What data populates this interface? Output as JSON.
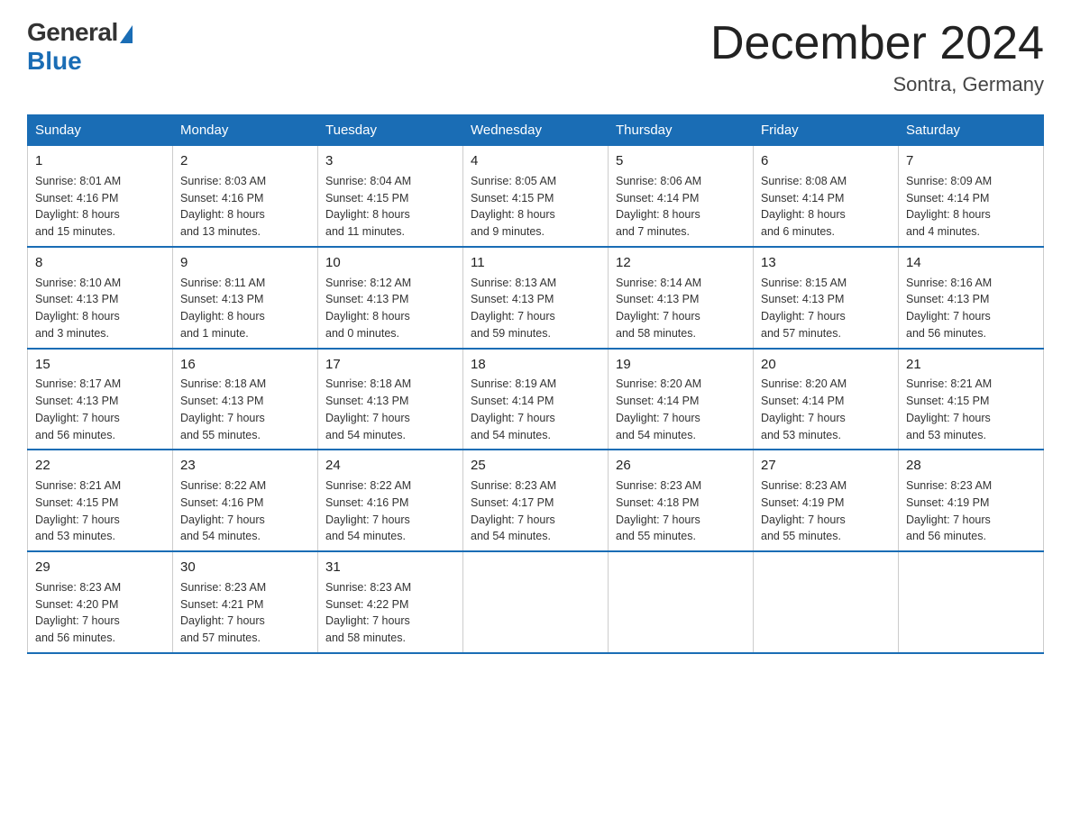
{
  "logo": {
    "general": "General",
    "blue": "Blue"
  },
  "title": "December 2024",
  "location": "Sontra, Germany",
  "days_of_week": [
    "Sunday",
    "Monday",
    "Tuesday",
    "Wednesday",
    "Thursday",
    "Friday",
    "Saturday"
  ],
  "weeks": [
    [
      {
        "day": "1",
        "info": "Sunrise: 8:01 AM\nSunset: 4:16 PM\nDaylight: 8 hours\nand 15 minutes."
      },
      {
        "day": "2",
        "info": "Sunrise: 8:03 AM\nSunset: 4:16 PM\nDaylight: 8 hours\nand 13 minutes."
      },
      {
        "day": "3",
        "info": "Sunrise: 8:04 AM\nSunset: 4:15 PM\nDaylight: 8 hours\nand 11 minutes."
      },
      {
        "day": "4",
        "info": "Sunrise: 8:05 AM\nSunset: 4:15 PM\nDaylight: 8 hours\nand 9 minutes."
      },
      {
        "day": "5",
        "info": "Sunrise: 8:06 AM\nSunset: 4:14 PM\nDaylight: 8 hours\nand 7 minutes."
      },
      {
        "day": "6",
        "info": "Sunrise: 8:08 AM\nSunset: 4:14 PM\nDaylight: 8 hours\nand 6 minutes."
      },
      {
        "day": "7",
        "info": "Sunrise: 8:09 AM\nSunset: 4:14 PM\nDaylight: 8 hours\nand 4 minutes."
      }
    ],
    [
      {
        "day": "8",
        "info": "Sunrise: 8:10 AM\nSunset: 4:13 PM\nDaylight: 8 hours\nand 3 minutes."
      },
      {
        "day": "9",
        "info": "Sunrise: 8:11 AM\nSunset: 4:13 PM\nDaylight: 8 hours\nand 1 minute."
      },
      {
        "day": "10",
        "info": "Sunrise: 8:12 AM\nSunset: 4:13 PM\nDaylight: 8 hours\nand 0 minutes."
      },
      {
        "day": "11",
        "info": "Sunrise: 8:13 AM\nSunset: 4:13 PM\nDaylight: 7 hours\nand 59 minutes."
      },
      {
        "day": "12",
        "info": "Sunrise: 8:14 AM\nSunset: 4:13 PM\nDaylight: 7 hours\nand 58 minutes."
      },
      {
        "day": "13",
        "info": "Sunrise: 8:15 AM\nSunset: 4:13 PM\nDaylight: 7 hours\nand 57 minutes."
      },
      {
        "day": "14",
        "info": "Sunrise: 8:16 AM\nSunset: 4:13 PM\nDaylight: 7 hours\nand 56 minutes."
      }
    ],
    [
      {
        "day": "15",
        "info": "Sunrise: 8:17 AM\nSunset: 4:13 PM\nDaylight: 7 hours\nand 56 minutes."
      },
      {
        "day": "16",
        "info": "Sunrise: 8:18 AM\nSunset: 4:13 PM\nDaylight: 7 hours\nand 55 minutes."
      },
      {
        "day": "17",
        "info": "Sunrise: 8:18 AM\nSunset: 4:13 PM\nDaylight: 7 hours\nand 54 minutes."
      },
      {
        "day": "18",
        "info": "Sunrise: 8:19 AM\nSunset: 4:14 PM\nDaylight: 7 hours\nand 54 minutes."
      },
      {
        "day": "19",
        "info": "Sunrise: 8:20 AM\nSunset: 4:14 PM\nDaylight: 7 hours\nand 54 minutes."
      },
      {
        "day": "20",
        "info": "Sunrise: 8:20 AM\nSunset: 4:14 PM\nDaylight: 7 hours\nand 53 minutes."
      },
      {
        "day": "21",
        "info": "Sunrise: 8:21 AM\nSunset: 4:15 PM\nDaylight: 7 hours\nand 53 minutes."
      }
    ],
    [
      {
        "day": "22",
        "info": "Sunrise: 8:21 AM\nSunset: 4:15 PM\nDaylight: 7 hours\nand 53 minutes."
      },
      {
        "day": "23",
        "info": "Sunrise: 8:22 AM\nSunset: 4:16 PM\nDaylight: 7 hours\nand 54 minutes."
      },
      {
        "day": "24",
        "info": "Sunrise: 8:22 AM\nSunset: 4:16 PM\nDaylight: 7 hours\nand 54 minutes."
      },
      {
        "day": "25",
        "info": "Sunrise: 8:23 AM\nSunset: 4:17 PM\nDaylight: 7 hours\nand 54 minutes."
      },
      {
        "day": "26",
        "info": "Sunrise: 8:23 AM\nSunset: 4:18 PM\nDaylight: 7 hours\nand 55 minutes."
      },
      {
        "day": "27",
        "info": "Sunrise: 8:23 AM\nSunset: 4:19 PM\nDaylight: 7 hours\nand 55 minutes."
      },
      {
        "day": "28",
        "info": "Sunrise: 8:23 AM\nSunset: 4:19 PM\nDaylight: 7 hours\nand 56 minutes."
      }
    ],
    [
      {
        "day": "29",
        "info": "Sunrise: 8:23 AM\nSunset: 4:20 PM\nDaylight: 7 hours\nand 56 minutes."
      },
      {
        "day": "30",
        "info": "Sunrise: 8:23 AM\nSunset: 4:21 PM\nDaylight: 7 hours\nand 57 minutes."
      },
      {
        "day": "31",
        "info": "Sunrise: 8:23 AM\nSunset: 4:22 PM\nDaylight: 7 hours\nand 58 minutes."
      },
      null,
      null,
      null,
      null
    ]
  ]
}
